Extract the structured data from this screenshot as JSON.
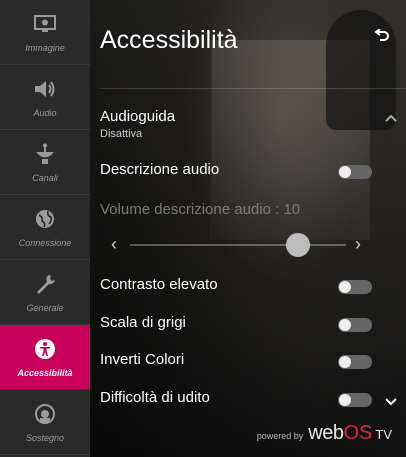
{
  "sidebar": {
    "items": [
      {
        "label": "Immagine",
        "icon": "picture-icon",
        "active": false
      },
      {
        "label": "Audio",
        "icon": "speaker-icon",
        "active": false
      },
      {
        "label": "Canali",
        "icon": "satellite-dish-icon",
        "active": false
      },
      {
        "label": "Connessione",
        "icon": "globe-icon",
        "active": false
      },
      {
        "label": "Generale",
        "icon": "wrench-icon",
        "active": false
      },
      {
        "label": "Accessibilità",
        "icon": "accessibility-icon",
        "active": true
      },
      {
        "label": "Sostegno",
        "icon": "support-icon",
        "active": false
      }
    ],
    "active_color": "#c8005a"
  },
  "header": {
    "title": "Accessibilità",
    "back_icon": "back-arrow-icon"
  },
  "settings": {
    "audioguida": {
      "label": "Audioguida",
      "value": "Disattiva"
    },
    "descrizione_audio": {
      "label": "Descrizione audio",
      "enabled": false
    },
    "volume": {
      "label": "Volume descrizione audio : 10",
      "value": 10
    },
    "contrasto": {
      "label": "Contrasto elevato",
      "enabled": false
    },
    "scala_grigi": {
      "label": "Scala di grigi",
      "enabled": false
    },
    "inverti_colori": {
      "label": "Inverti Colori",
      "enabled": false
    },
    "difficolta_udito": {
      "label": "Difficoltà di udito",
      "enabled": false
    }
  },
  "brand": {
    "powered_by": "powered by",
    "name_web": "web",
    "name_os": "OS",
    "name_tv": "TV",
    "os_color": "#e0224b"
  }
}
